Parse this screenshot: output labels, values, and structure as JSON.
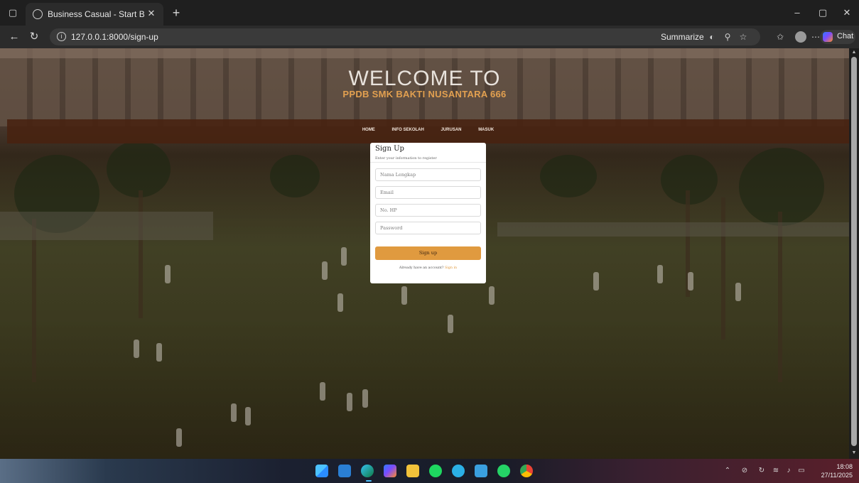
{
  "browser": {
    "tab_title": "Business Casual - Start Bootstrap",
    "url": "127.0.0.1:8000/sign-up",
    "summarize_label": "Summarize",
    "chat_label": "Chat",
    "icons": {
      "sidebar": "tab-actions-icon",
      "tab": "globe-icon",
      "close": "close-icon",
      "new_tab": "plus-icon",
      "back": "back-arrow-icon",
      "refresh": "refresh-icon",
      "info": "info-icon",
      "summarize": "summarize-icon",
      "zoom": "zoom-icon",
      "favorite": "star-icon",
      "favorites": "favorites-icon",
      "profile": "avatar",
      "more": "more-icon"
    }
  },
  "page": {
    "welcome": "WELCOME TO",
    "subtitle": "PPDB SMK BAKTI NUSANTARA 666",
    "nav": [
      "HOME",
      "INFO SEKOLAH",
      "JURUSAN",
      "MASUK"
    ]
  },
  "form": {
    "title": "Sign Up",
    "subtitle": "Enter your information to register",
    "fields": [
      {
        "name": "nama",
        "placeholder": "Nama Lengkap"
      },
      {
        "name": "email",
        "placeholder": "Email"
      },
      {
        "name": "hp",
        "placeholder": "No. HP"
      },
      {
        "name": "password",
        "placeholder": "Password"
      }
    ],
    "submit_label": "Sign up",
    "footer_text": "Already have an account?",
    "footer_link": "Sign in"
  },
  "taskbar": {
    "time": "18:08",
    "date": "27/11/2025",
    "apps": [
      "windows-start-icon",
      "vscode-icon",
      "edge-icon",
      "copilot-icon",
      "file-explorer-icon",
      "spotify-icon",
      "app-icon",
      "mail-icon",
      "whatsapp-icon",
      "chrome-icon"
    ]
  },
  "colors": {
    "accent": "#e09a3f",
    "nav_band": "#48220f",
    "subtitle": "#e2a050"
  }
}
